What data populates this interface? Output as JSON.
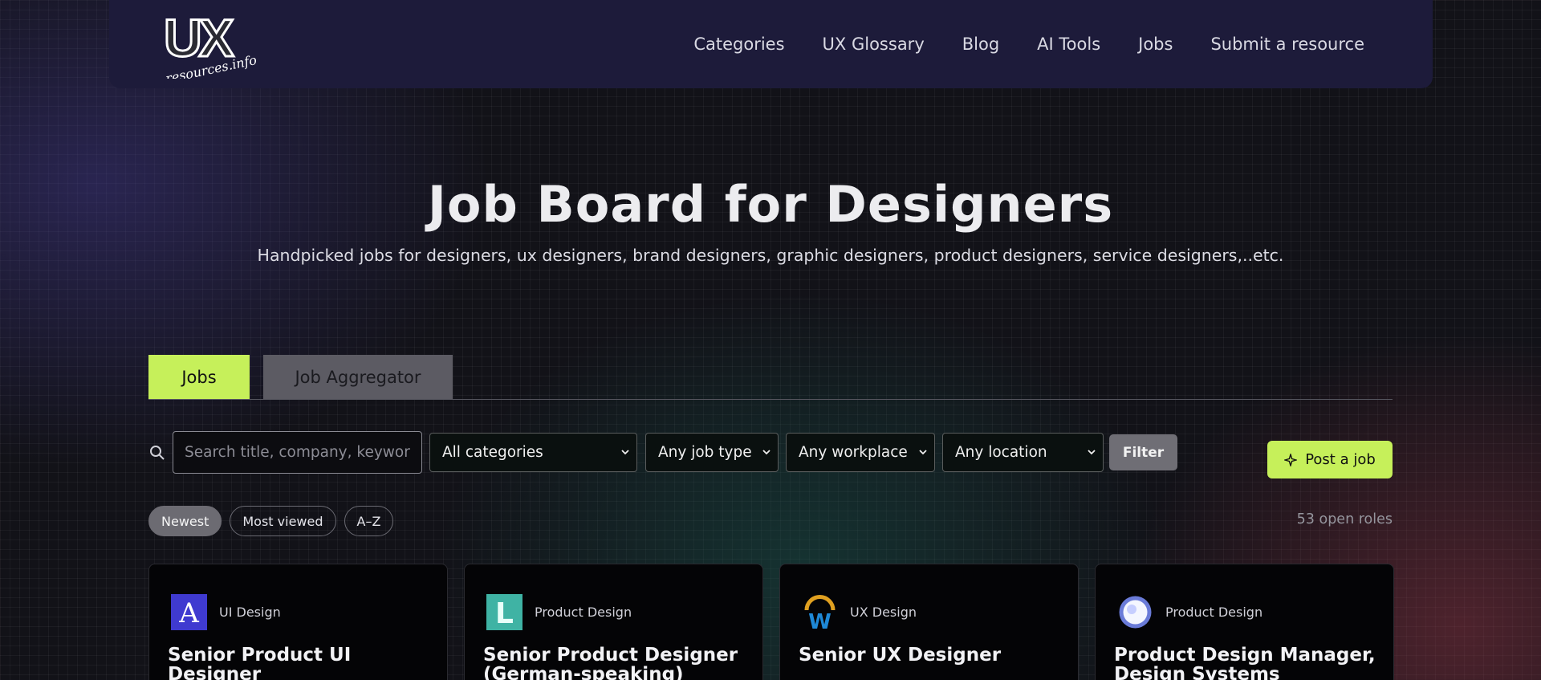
{
  "header": {
    "logo_text": "UX",
    "logo_subtext": "resources.info",
    "nav": [
      "Categories",
      "UX Glossary",
      "Blog",
      "AI Tools",
      "Jobs",
      "Submit a resource"
    ]
  },
  "hero": {
    "title": "Job Board for Designers",
    "subtitle": "Handpicked jobs for designers, ux designers, brand designers, graphic designers, product designers, service designers,..etc."
  },
  "tabs": {
    "active": "Jobs",
    "inactive": "Job Aggregator"
  },
  "filters": {
    "search_placeholder": "Search title, company, keyword...",
    "category": "All categories",
    "job_type": "Any job type",
    "workplace": "Any workplace",
    "location": "Any location",
    "filter_label": "Filter"
  },
  "post_job_label": "Post a job",
  "sort": {
    "newest": "Newest",
    "most_viewed": "Most viewed",
    "az": "A–Z"
  },
  "open_roles": "53 open roles",
  "colors": {
    "accent": "#c6f05a",
    "topbar": "#1d1b3a"
  },
  "jobs": [
    {
      "category": "UI Design",
      "title": "Senior Product UI Designer",
      "logo_letter": "A"
    },
    {
      "category": "Product Design",
      "title": "Senior Product Designer (German-speaking) Remote",
      "logo_letter": "L"
    },
    {
      "category": "UX Design",
      "title": "Senior UX Designer",
      "logo_letter": "W"
    },
    {
      "category": "Product Design",
      "title": "Product Design Manager, Design Systems",
      "logo_letter": ""
    }
  ]
}
